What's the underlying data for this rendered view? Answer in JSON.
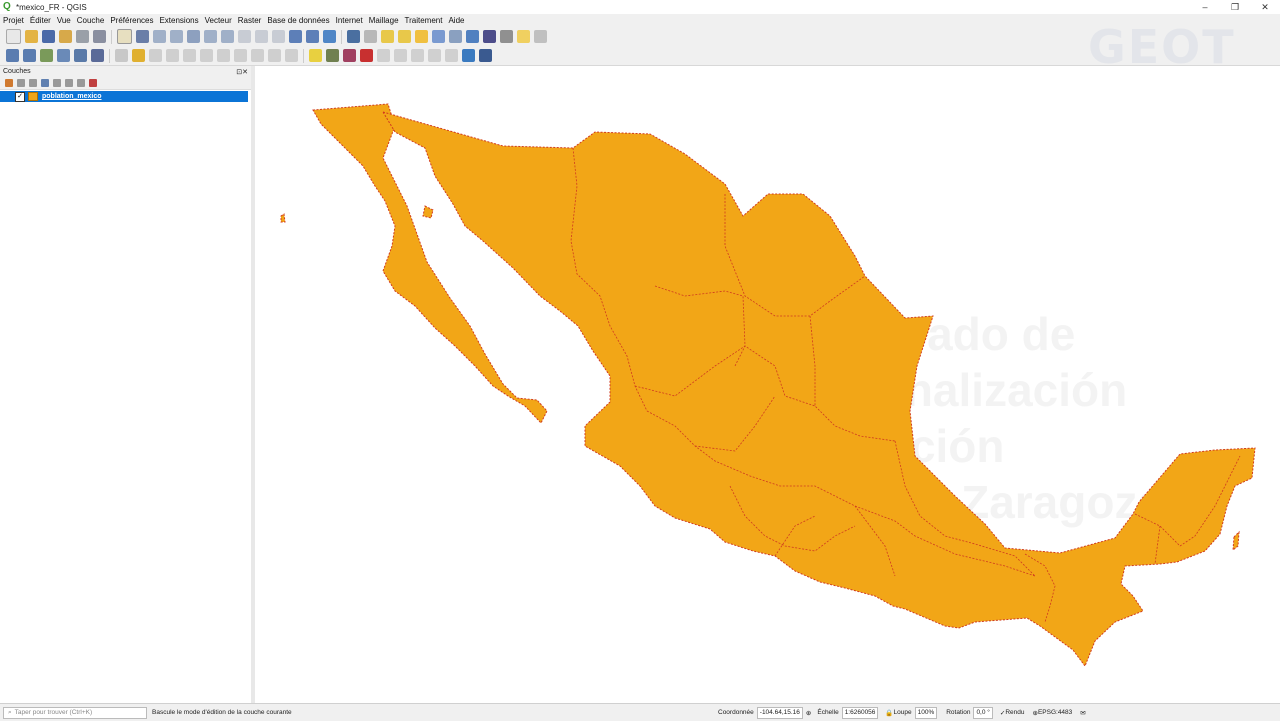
{
  "window": {
    "title": "*mexico_FR - QGIS",
    "controls": [
      "–",
      "❐",
      "✕"
    ]
  },
  "menu": [
    "Projet",
    "Éditer",
    "Vue",
    "Couche",
    "Préférences",
    "Extensions",
    "Vecteur",
    "Raster",
    "Base de données",
    "Internet",
    "Maillage",
    "Traitement",
    "Aide"
  ],
  "layers_panel": {
    "title": "Couches",
    "layers": [
      {
        "name": "poblation_mexico",
        "checked": true,
        "fill_color": "#f0a518"
      }
    ]
  },
  "map": {
    "fill_color": "#f2a617",
    "border_color": "#d03a1f"
  },
  "logo_text": "GEOT",
  "status": {
    "locator_placeholder": "Taper pour trouver (Ctrl+K)",
    "message": "Bascule le mode d'édition de la couche courante",
    "coord_label": "Coordonnée",
    "coord_value": "-104.64,15.16",
    "scale_label": "Échelle",
    "scale_value": "1:6260056",
    "magnifier_label": "Loupe",
    "magnifier_value": "100%",
    "rotation_label": "Rotation",
    "rotation_value": "0,0 °",
    "render_label": "Rendu",
    "crs": "EPSG:4483"
  }
}
